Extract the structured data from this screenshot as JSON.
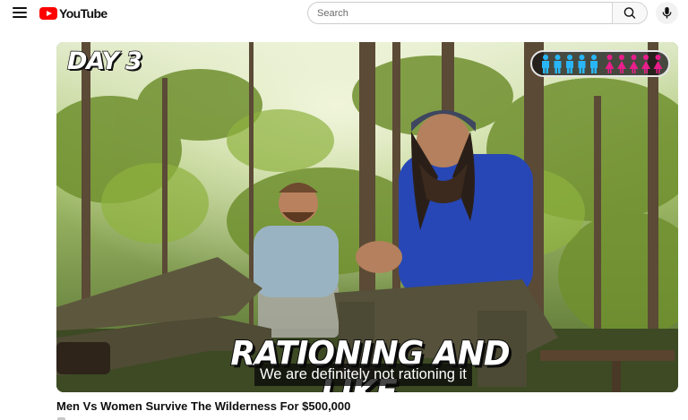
{
  "header": {
    "logo_text": "YouTube",
    "search": {
      "placeholder": "Search",
      "value": ""
    },
    "icons": {
      "menu": "hamburger-menu-icon",
      "search": "search-icon",
      "mic": "microphone-icon"
    }
  },
  "video": {
    "overlay_day": "DAY 3",
    "caption_big": "RATIONING AND LIKE..",
    "subtitle": "We are definitely not rationing it",
    "tracker": {
      "men_remaining": 5,
      "women_remaining": 5,
      "men_color": "#29b6f6",
      "women_color": "#e91e8c"
    },
    "title": "Men Vs Women Survive The Wilderness For $500,000"
  },
  "colors": {
    "brand": "#ff0000"
  }
}
